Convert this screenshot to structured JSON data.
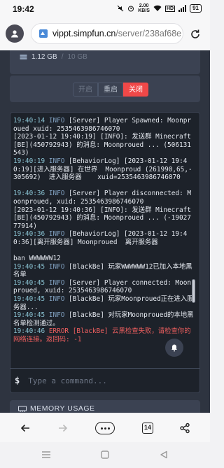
{
  "status_bar": {
    "time": "19:42",
    "net_speed_value": "2.00",
    "net_speed_unit": "KB/S",
    "wifi_badge": "6",
    "hd_badge": "HD",
    "battery": "91"
  },
  "browser": {
    "url_host": "vippt.simpfun.cn",
    "url_path": "/server/238af68e",
    "tabs_count": "14"
  },
  "disk": {
    "used": "1.12 GB",
    "separator": "/",
    "total": "10 GB"
  },
  "controls": {
    "start_label": "开启",
    "restart_label": "重启",
    "stop_label": "关闭"
  },
  "console": {
    "lines": [
      {
        "ts": "19:40:14",
        "level": "INFO",
        "text": " [Server] Player Spawned: Moonproued xuid: 2535463986746070"
      },
      {
        "ts": "",
        "level": "",
        "text": "[2023-01-12 19:40:19] [INFO]: 发送群 Minecraft[BE](450792943) 的消息: Moonproued ... (506131543)"
      },
      {
        "ts": "19:40:19",
        "level": "INFO",
        "text": " [BehaviorLog] [2023-01-12 19:40:19][进入服务器] 在世界  Moonproud (261990,65,-305692)  进入服务器    xuid=2535463986746070"
      },
      {
        "ts": "",
        "level": "",
        "text": ""
      },
      {
        "ts": "19:40:36",
        "level": "INFO",
        "text": " [Server] Player disconnected: Moonproued, xuid: 2535463986746070"
      },
      {
        "ts": "",
        "level": "",
        "text": "[2023-01-12 19:40:36] [INFO]: 发送群 Minecraft[BE](450792943) 的消息: Moonproued ... (-1902777914)"
      },
      {
        "ts": "19:40:36",
        "level": "INFO",
        "text": " [BehaviorLog] [2023-01-12 19:40:36][离开服务器] Moonproued  离开服务器"
      },
      {
        "ts": "",
        "level": "",
        "text": ""
      },
      {
        "ts": "",
        "level": "",
        "text": "ban WWWWWW12"
      },
      {
        "ts": "19:40:45",
        "level": "INFO",
        "text": " [BlackBe] 玩家WWWWWW12已加入本地黑名单"
      },
      {
        "ts": "19:40:45",
        "level": "INFO",
        "text": " [Server] Player connected: Moonproued, xuid: 2535463986746070"
      },
      {
        "ts": "19:40:45",
        "level": "INFO",
        "text": " [BlackBe] 玩家Moonproued正在进入服务器..."
      },
      {
        "ts": "19:40:45",
        "level": "INFO",
        "text": " [BlackBe] 对玩家Moonproued的本地黑名单检测通过。"
      },
      {
        "ts": "19:40:46",
        "level": "ERROR",
        "text": " [BlackBe] 云黑检查失败，请检查你的网络连接。返回码: -1"
      }
    ]
  },
  "command": {
    "prompt": "$",
    "placeholder": "Type a command..."
  },
  "memory": {
    "title": "MEMORY USAGE"
  },
  "colors": {
    "page_bg": "#2e3440",
    "console_bg": "#1d222a",
    "timestamp": "#88c0d0",
    "info": "#81a1c1",
    "error": "#ef5f5f",
    "stop_button": "#f04848"
  }
}
